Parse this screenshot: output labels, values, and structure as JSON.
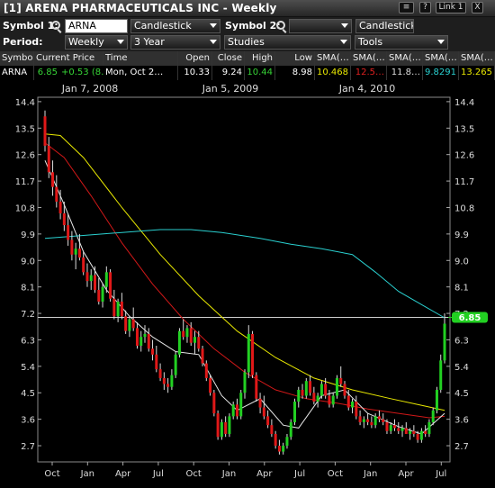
{
  "window": {
    "title": "[1] ARENA PHARMACEUTICALS INC - Weekly",
    "buttons": {
      "menu": "≡",
      "help": "?",
      "link": "Link 1",
      "close": "X"
    }
  },
  "toolbar": {
    "symbol1_label": "Symbol 1:",
    "symbol1_value": "ARNA",
    "chart_type": "Candlestick",
    "symbol2_label": "Symbol 2:",
    "symbol2_value": "",
    "chart_type2": "Candlestick",
    "period_label": "Period:",
    "period": "Weekly",
    "range": "3 Year",
    "studies": "Studies",
    "tools": "Tools"
  },
  "quote": {
    "headers": [
      "Symbol",
      "Current Price",
      "Time",
      "Open",
      "Close",
      "High",
      "Low",
      "SMA(…",
      "SMA(…",
      "SMA(…",
      "SMA(…",
      "SMA(…"
    ],
    "values": [
      "ARNA",
      "6.85",
      "+0.53 (8…",
      "Mon, Oct 2…",
      "10.33",
      "9.24",
      "10.44",
      "8.98",
      "10.468",
      "12.5…",
      "11.8…",
      "9.8291",
      "13.265"
    ],
    "colors": {
      "price": "#36d436",
      "change": "#36d436",
      "high": "#36d436",
      "sma1": "#e8e800",
      "sma2": "#e02020",
      "sma3": "#dddddd",
      "sma4": "#2ad0d0",
      "sma5": "#e8e800"
    }
  },
  "chart_data": {
    "type": "candlestick",
    "symbol": "ARNA",
    "period": "Weekly",
    "top_axis_labels": [
      "Jan 7, 2008",
      "Jan 5, 2009",
      "Jan 4, 2010"
    ],
    "bottom_axis_labels": [
      "Oct",
      "Jan",
      "Apr",
      "Jul",
      "Oct",
      "Jan",
      "Apr",
      "Jul",
      "Oct",
      "Jan",
      "Apr",
      "Jul"
    ],
    "y_ticks": [
      14.4,
      13.5,
      12.6,
      11.7,
      10.8,
      9.9,
      9.0,
      8.1,
      7.2,
      6.3,
      5.4,
      4.5,
      3.6,
      2.7
    ],
    "ylim": [
      2.15,
      14.55
    ],
    "current_price": 6.85,
    "current_price_label": "6.85",
    "colors": {
      "up": "#22d022",
      "down": "#e01818",
      "sma_yellow": "#e8e800",
      "sma_red": "#d01818",
      "sma_white": "#e8e8e8",
      "sma_cyan": "#2ad0d0"
    },
    "ohlc": [
      [
        13.9,
        14.1,
        12.7,
        12.9
      ],
      [
        12.9,
        13.2,
        11.8,
        12.0
      ],
      [
        12.0,
        12.4,
        11.2,
        11.5
      ],
      [
        11.5,
        11.9,
        10.8,
        11.0
      ],
      [
        11.0,
        11.4,
        10.4,
        10.6
      ],
      [
        10.6,
        11.0,
        10.0,
        10.2
      ],
      [
        10.2,
        10.6,
        9.5,
        9.7
      ],
      [
        9.7,
        10.0,
        9.0,
        9.2
      ],
      [
        9.2,
        9.6,
        8.7,
        9.4
      ],
      [
        9.4,
        9.9,
        9.0,
        9.1
      ],
      [
        9.1,
        9.3,
        8.5,
        8.6
      ],
      [
        8.6,
        8.9,
        8.1,
        8.3
      ],
      [
        8.3,
        8.7,
        8.0,
        8.5
      ],
      [
        8.5,
        8.8,
        7.9,
        8.0
      ],
      [
        8.0,
        8.4,
        7.5,
        7.6
      ],
      [
        7.6,
        8.2,
        7.4,
        8.1
      ],
      [
        8.1,
        8.8,
        7.9,
        8.6
      ],
      [
        8.6,
        8.7,
        7.6,
        7.7
      ],
      [
        7.7,
        8.0,
        7.0,
        7.1
      ],
      [
        7.1,
        7.7,
        6.9,
        7.6
      ],
      [
        7.6,
        7.9,
        7.0,
        7.1
      ],
      [
        7.1,
        7.3,
        6.5,
        6.6
      ],
      [
        6.6,
        7.1,
        6.4,
        7.0
      ],
      [
        7.0,
        7.4,
        6.6,
        6.7
      ],
      [
        6.7,
        6.9,
        6.0,
        6.1
      ],
      [
        6.1,
        6.6,
        5.9,
        6.4
      ],
      [
        6.4,
        6.8,
        6.2,
        6.5
      ],
      [
        6.5,
        6.7,
        5.9,
        6.0
      ],
      [
        6.0,
        6.3,
        5.6,
        5.8
      ],
      [
        5.8,
        6.1,
        5.2,
        5.3
      ],
      [
        5.3,
        5.5,
        4.9,
        5.0
      ],
      [
        5.0,
        5.2,
        4.6,
        4.8
      ],
      [
        4.8,
        5.0,
        4.5,
        4.7
      ],
      [
        4.7,
        5.3,
        4.6,
        5.1
      ],
      [
        5.1,
        5.9,
        5.0,
        5.8
      ],
      [
        5.8,
        6.7,
        5.7,
        6.6
      ],
      [
        6.6,
        7.0,
        6.3,
        6.4
      ],
      [
        6.4,
        6.8,
        6.2,
        6.7
      ],
      [
        6.7,
        6.9,
        6.1,
        6.2
      ],
      [
        6.2,
        6.6,
        5.8,
        6.4
      ],
      [
        6.4,
        6.6,
        5.9,
        6.0
      ],
      [
        6.0,
        6.1,
        5.4,
        5.5
      ],
      [
        5.5,
        5.6,
        4.9,
        5.0
      ],
      [
        5.0,
        5.1,
        4.4,
        4.5
      ],
      [
        4.5,
        4.6,
        3.7,
        3.8
      ],
      [
        3.8,
        3.9,
        2.9,
        3.0
      ],
      [
        3.0,
        3.6,
        2.9,
        3.5
      ],
      [
        3.5,
        3.7,
        3.0,
        3.1
      ],
      [
        3.1,
        3.8,
        3.0,
        3.7
      ],
      [
        3.7,
        4.2,
        3.6,
        4.1
      ],
      [
        4.1,
        4.3,
        3.6,
        3.7
      ],
      [
        3.7,
        4.6,
        3.6,
        4.5
      ],
      [
        4.5,
        5.3,
        4.3,
        5.2
      ],
      [
        5.2,
        6.8,
        5.0,
        6.5
      ],
      [
        6.5,
        6.6,
        5.0,
        5.1
      ],
      [
        5.1,
        5.2,
        4.2,
        4.3
      ],
      [
        4.3,
        4.5,
        3.8,
        4.0
      ],
      [
        4.0,
        4.4,
        3.6,
        3.7
      ],
      [
        3.7,
        3.9,
        3.3,
        3.4
      ],
      [
        3.4,
        3.6,
        3.0,
        3.1
      ],
      [
        3.1,
        3.2,
        2.6,
        2.7
      ],
      [
        2.7,
        2.9,
        2.4,
        2.5
      ],
      [
        2.5,
        2.8,
        2.4,
        2.7
      ],
      [
        2.7,
        3.1,
        2.6,
        3.0
      ],
      [
        3.0,
        3.6,
        2.9,
        3.5
      ],
      [
        3.5,
        4.3,
        3.4,
        4.2
      ],
      [
        4.2,
        4.7,
        4.0,
        4.6
      ],
      [
        4.6,
        4.8,
        4.3,
        4.4
      ],
      [
        4.4,
        5.0,
        4.3,
        4.9
      ],
      [
        4.9,
        5.1,
        4.4,
        4.5
      ],
      [
        4.5,
        4.7,
        4.1,
        4.2
      ],
      [
        4.2,
        4.5,
        4.0,
        4.4
      ],
      [
        4.4,
        4.9,
        4.3,
        4.8
      ],
      [
        4.8,
        5.0,
        4.3,
        4.4
      ],
      [
        4.4,
        4.6,
        4.0,
        4.1
      ],
      [
        4.1,
        4.5,
        4.0,
        4.4
      ],
      [
        4.4,
        5.1,
        4.3,
        5.0
      ],
      [
        5.0,
        5.4,
        4.7,
        4.8
      ],
      [
        4.8,
        4.9,
        4.3,
        4.4
      ],
      [
        4.4,
        4.6,
        3.9,
        4.0
      ],
      [
        4.0,
        4.3,
        3.8,
        4.2
      ],
      [
        4.2,
        4.4,
        3.6,
        3.7
      ],
      [
        3.7,
        3.9,
        3.4,
        3.5
      ],
      [
        3.5,
        3.7,
        3.3,
        3.6
      ],
      [
        3.6,
        3.8,
        3.4,
        3.5
      ],
      [
        3.5,
        3.7,
        3.3,
        3.4
      ],
      [
        3.4,
        3.8,
        3.3,
        3.7
      ],
      [
        3.7,
        3.9,
        3.5,
        3.6
      ],
      [
        3.6,
        3.8,
        3.4,
        3.5
      ],
      [
        3.5,
        3.6,
        3.1,
        3.2
      ],
      [
        3.2,
        3.5,
        3.1,
        3.4
      ],
      [
        3.4,
        3.6,
        3.2,
        3.3
      ],
      [
        3.3,
        3.5,
        3.1,
        3.2
      ],
      [
        3.2,
        3.4,
        3.0,
        3.3
      ],
      [
        3.3,
        3.5,
        3.1,
        3.1
      ],
      [
        3.1,
        3.3,
        2.9,
        3.2
      ],
      [
        3.2,
        3.4,
        3.0,
        3.1
      ],
      [
        3.1,
        3.2,
        2.8,
        2.9
      ],
      [
        2.9,
        3.3,
        2.8,
        3.2
      ],
      [
        3.2,
        3.4,
        3.0,
        3.1
      ],
      [
        3.1,
        3.6,
        3.0,
        3.5
      ],
      [
        3.5,
        4.0,
        3.4,
        3.9
      ],
      [
        3.9,
        4.7,
        3.8,
        4.6
      ],
      [
        4.6,
        5.8,
        4.5,
        5.6
      ],
      [
        5.6,
        7.2,
        5.5,
        6.85
      ]
    ],
    "sma_series": [
      {
        "color": "yellow",
        "points": [
          [
            0,
            13.3
          ],
          [
            4,
            13.25
          ],
          [
            10,
            12.5
          ],
          [
            20,
            10.8
          ],
          [
            30,
            9.2
          ],
          [
            40,
            7.8
          ],
          [
            50,
            6.6
          ],
          [
            60,
            5.7
          ],
          [
            70,
            5.0
          ],
          [
            80,
            4.6
          ],
          [
            90,
            4.3
          ],
          [
            97,
            4.1
          ],
          [
            104,
            3.9
          ]
        ]
      },
      {
        "color": "red",
        "points": [
          [
            0,
            13.0
          ],
          [
            5,
            12.5
          ],
          [
            12,
            11.2
          ],
          [
            20,
            9.6
          ],
          [
            28,
            8.2
          ],
          [
            36,
            7.0
          ],
          [
            44,
            6.0
          ],
          [
            52,
            5.2
          ],
          [
            60,
            4.6
          ],
          [
            68,
            4.3
          ],
          [
            76,
            4.15
          ],
          [
            84,
            3.95
          ],
          [
            92,
            3.8
          ],
          [
            100,
            3.65
          ],
          [
            104,
            3.7
          ]
        ]
      },
      {
        "color": "white",
        "points": [
          [
            0,
            12.4
          ],
          [
            5,
            10.9
          ],
          [
            10,
            9.3
          ],
          [
            16,
            8.0
          ],
          [
            22,
            7.1
          ],
          [
            28,
            6.4
          ],
          [
            34,
            5.9
          ],
          [
            40,
            5.8
          ],
          [
            46,
            4.4
          ],
          [
            50,
            3.9
          ],
          [
            56,
            4.3
          ],
          [
            62,
            3.4
          ],
          [
            66,
            3.3
          ],
          [
            72,
            4.4
          ],
          [
            78,
            4.6
          ],
          [
            84,
            3.8
          ],
          [
            92,
            3.35
          ],
          [
            98,
            3.1
          ],
          [
            104,
            3.8
          ]
        ]
      },
      {
        "color": "cyan",
        "points": [
          [
            0,
            9.75
          ],
          [
            10,
            9.85
          ],
          [
            20,
            9.95
          ],
          [
            30,
            10.05
          ],
          [
            38,
            10.05
          ],
          [
            46,
            9.95
          ],
          [
            56,
            9.75
          ],
          [
            64,
            9.55
          ],
          [
            72,
            9.4
          ],
          [
            80,
            9.2
          ],
          [
            86,
            8.6
          ],
          [
            92,
            7.95
          ],
          [
            98,
            7.5
          ],
          [
            104,
            7.05
          ]
        ]
      }
    ]
  }
}
